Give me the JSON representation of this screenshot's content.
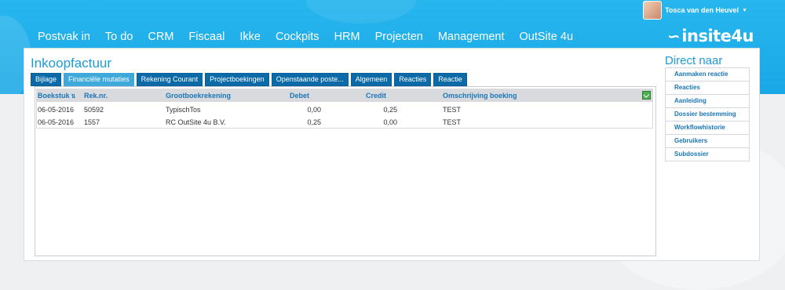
{
  "user": {
    "name": "Tosca van den Heuvel"
  },
  "nav": [
    "Postvak in",
    "To do",
    "CRM",
    "Fiscaal",
    "Ikke",
    "Cockpits",
    "HRM",
    "Projecten",
    "Management",
    "OutSite 4u"
  ],
  "logo": "insite4u",
  "page": {
    "title": "Inkoopfactuur"
  },
  "tabs": [
    {
      "label": "Bijlage",
      "active": false
    },
    {
      "label": "Financiële mutaties",
      "active": true
    },
    {
      "label": "Rekening Courant",
      "active": false
    },
    {
      "label": "Projectboekingen",
      "active": false
    },
    {
      "label": "Openstaande poste...",
      "active": false
    },
    {
      "label": "Algemeen",
      "active": false
    },
    {
      "label": "Reacties",
      "active": false
    },
    {
      "label": "Reactie",
      "active": false
    }
  ],
  "table": {
    "headers": [
      "Boekstuk",
      "Rek.nr.",
      "Grootboekrekening",
      "Debet",
      "Credit",
      "Omschrijving boeking"
    ],
    "rows": [
      [
        "06-05-2016",
        "50592",
        "TypischTos",
        "0,00",
        "0,25",
        "TEST"
      ],
      [
        "06-05-2016",
        "1557",
        "RC OutSite 4u B.V.",
        "0,25",
        "0,00",
        "TEST"
      ]
    ]
  },
  "direct": {
    "title": "Direct naar",
    "items": [
      "Aanmaken reactie",
      "Reacties",
      "Aanleiding",
      "Dossier bestemming",
      "Workflowhistorie",
      "Gebruikers",
      "Subdossier"
    ]
  },
  "colors": {
    "header_blue": "#1ea9e6",
    "tab_blue": "#0b6aa7",
    "tab_active": "#3fa9dc",
    "link_blue": "#1876b8"
  }
}
